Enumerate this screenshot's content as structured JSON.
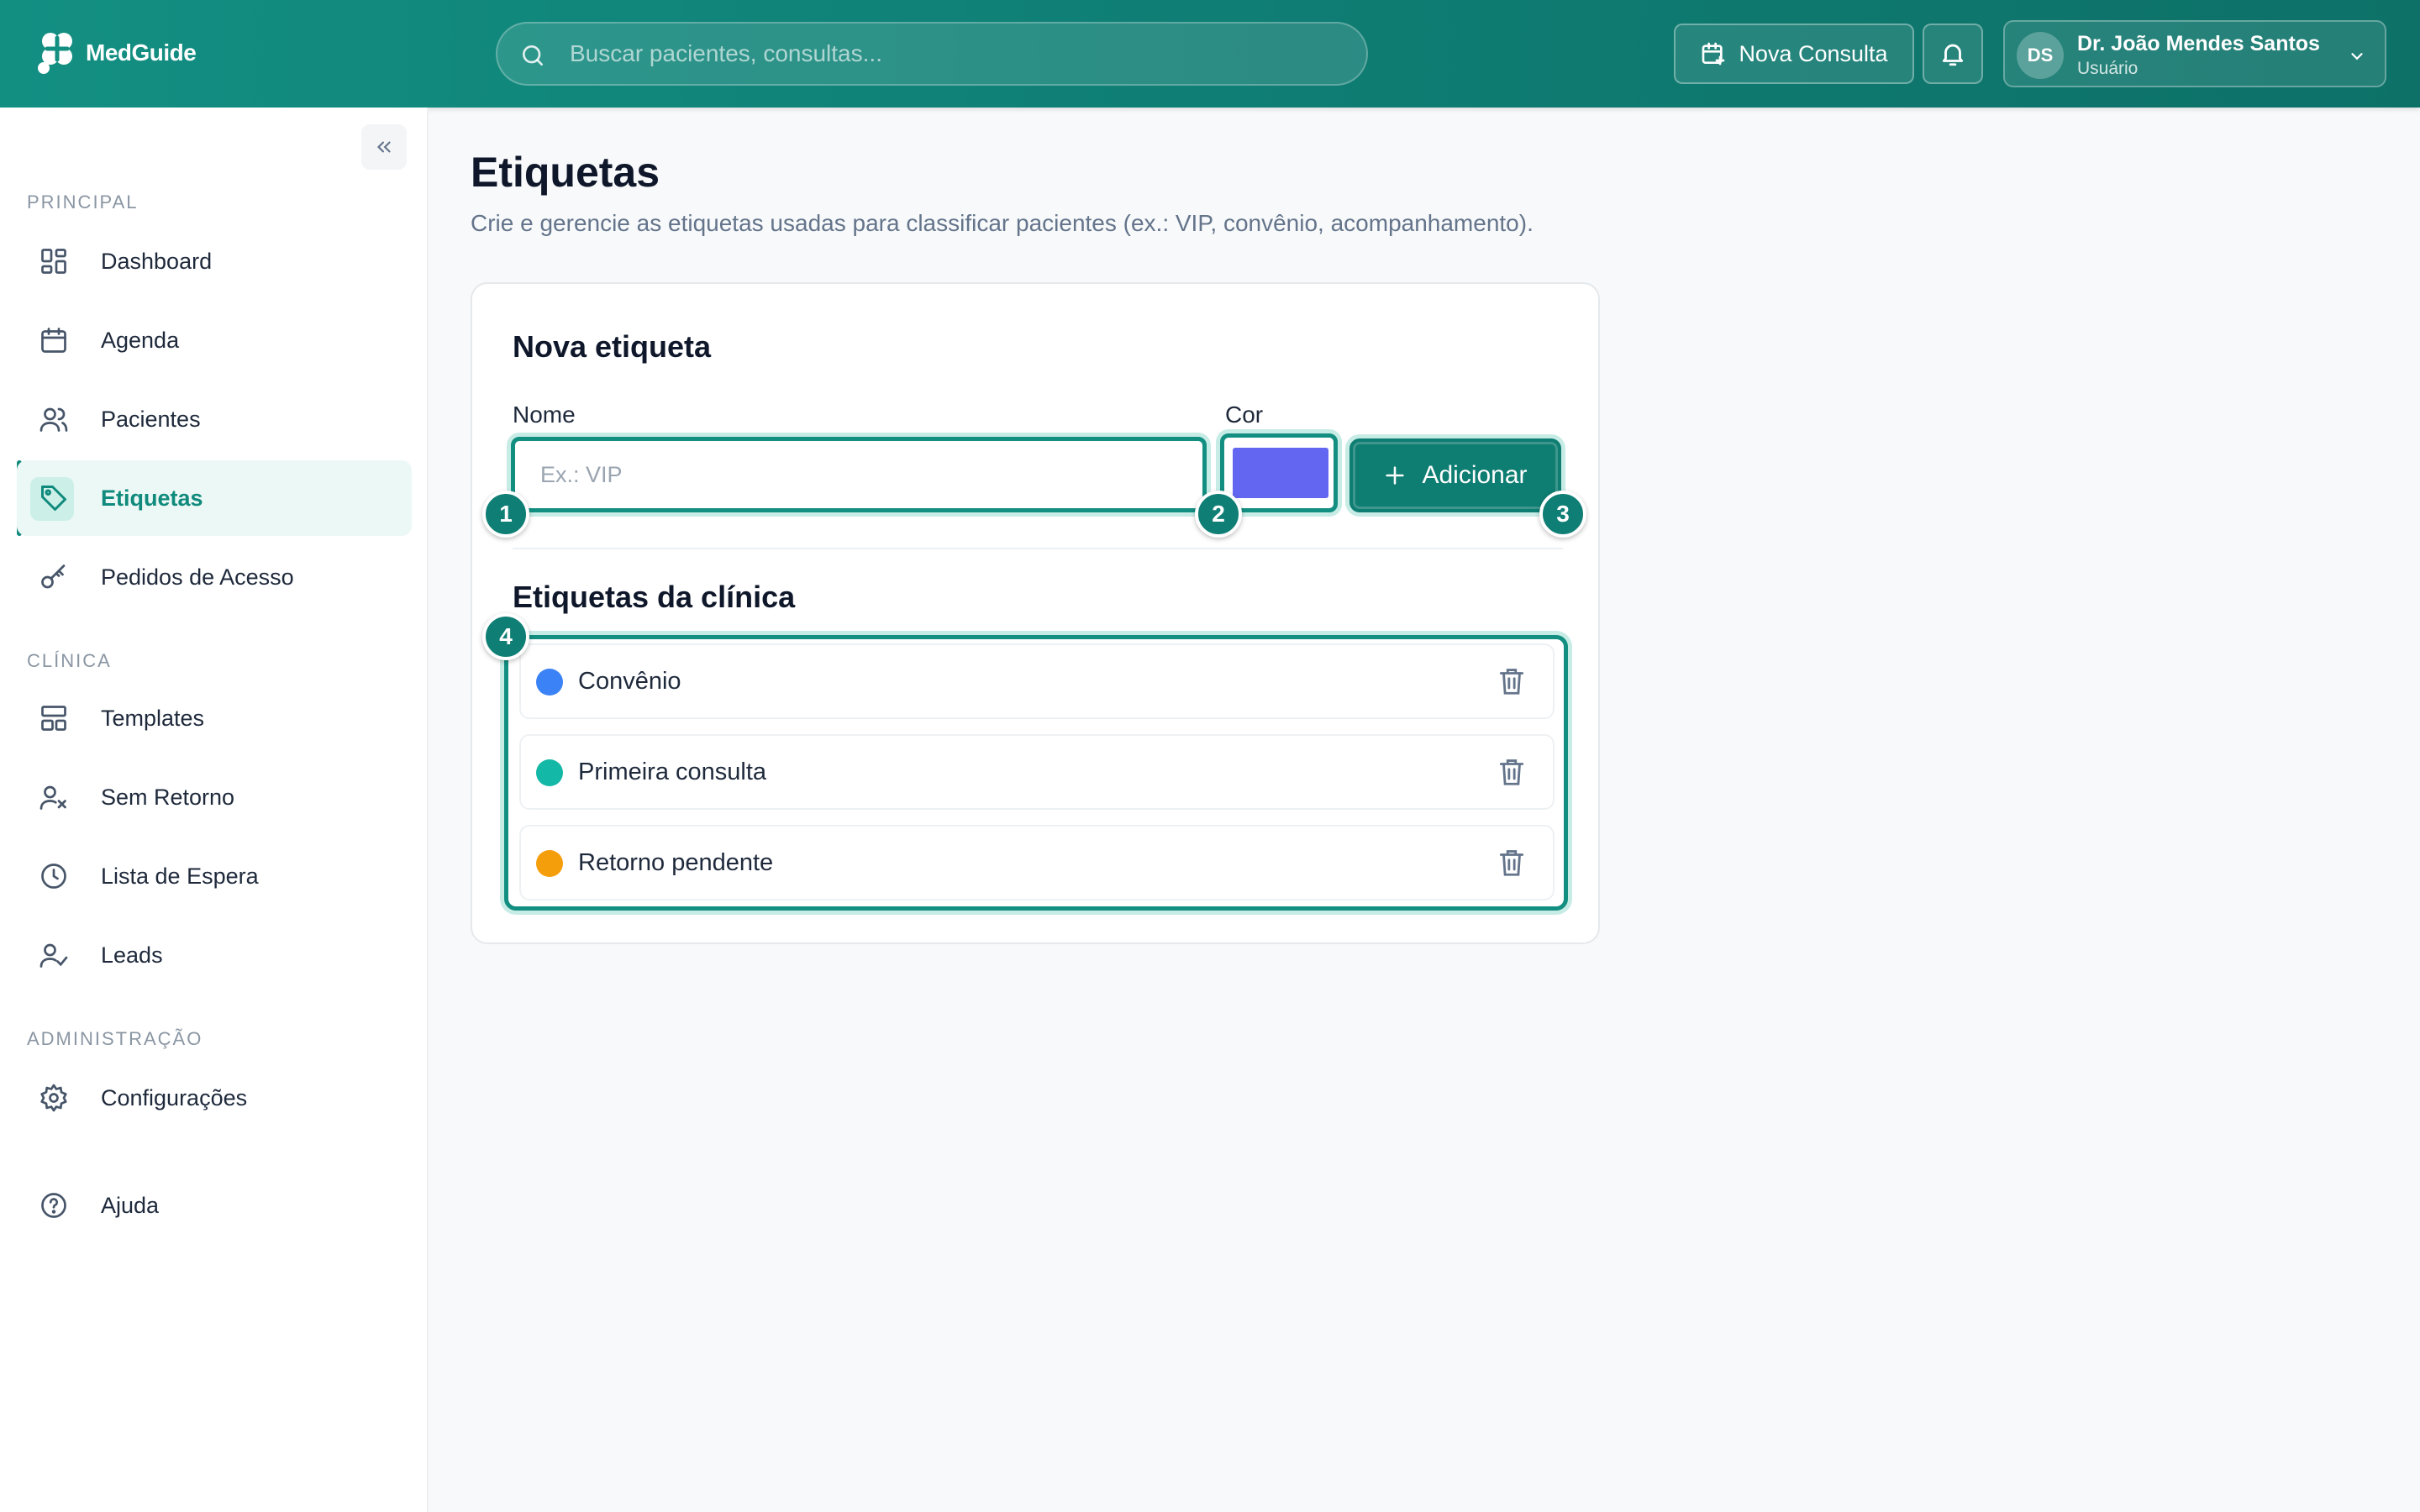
{
  "app": {
    "name": "MedGuide"
  },
  "header": {
    "search_placeholder": "Buscar pacientes, consultas...",
    "new_consult_label": "Nova Consulta",
    "user": {
      "initials": "DS",
      "name": "Dr. João Mendes Santos",
      "role": "Usuário"
    }
  },
  "sidebar": {
    "sections": [
      {
        "title": "PRINCIPAL"
      },
      {
        "title": "CLÍNICA"
      },
      {
        "title": "ADMINISTRAÇÃO"
      }
    ],
    "items": [
      {
        "label": "Dashboard",
        "icon": "dashboard-icon"
      },
      {
        "label": "Agenda",
        "icon": "calendar-icon"
      },
      {
        "label": "Pacientes",
        "icon": "users-icon"
      },
      {
        "label": "Etiquetas",
        "icon": "tag-icon",
        "active": true
      },
      {
        "label": "Pedidos de Acesso",
        "icon": "key-icon"
      },
      {
        "label": "Templates",
        "icon": "layout-icon"
      },
      {
        "label": "Sem Retorno",
        "icon": "user-x-icon"
      },
      {
        "label": "Lista de Espera",
        "icon": "clock-icon"
      },
      {
        "label": "Leads",
        "icon": "user-check-icon"
      },
      {
        "label": "Configurações",
        "icon": "gear-icon"
      },
      {
        "label": "Ajuda",
        "icon": "help-icon"
      }
    ]
  },
  "page": {
    "title": "Etiquetas",
    "subtitle": "Crie e gerencie as etiquetas usadas para classificar pacientes (ex.: VIP, convênio, acompanhamento).",
    "form": {
      "title": "Nova etiqueta",
      "name_label": "Nome",
      "name_placeholder": "Ex.: VIP",
      "name_value": "",
      "color_label": "Cor",
      "color_value": "#6366f1",
      "add_label": "Adicionar"
    },
    "list": {
      "title": "Etiquetas da clínica",
      "tags": [
        {
          "name": "Convênio",
          "color": "#3b82f6"
        },
        {
          "name": "Primeira consulta",
          "color": "#14b8a6"
        },
        {
          "name": "Retorno pendente",
          "color": "#f59e0b"
        }
      ]
    },
    "callouts": [
      "1",
      "2",
      "3",
      "4"
    ]
  },
  "colors": {
    "brand": "#0f7e74",
    "accent_light": "#ecf8f5"
  }
}
